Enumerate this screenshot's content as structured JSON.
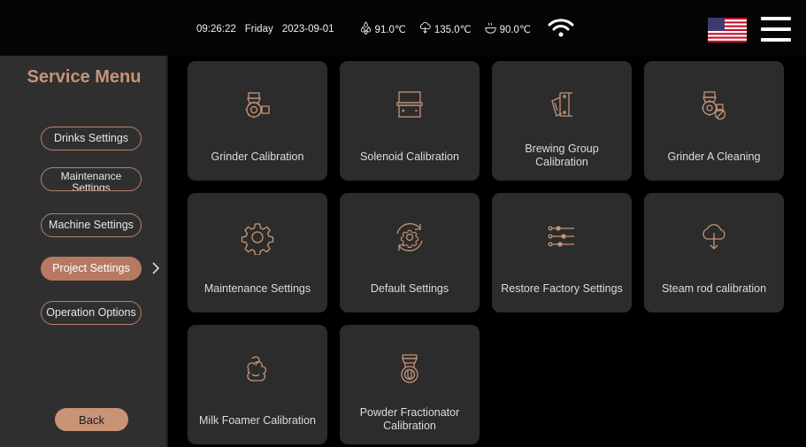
{
  "status": {
    "time": "09:26:22",
    "day": "Friday",
    "date": "2023-09-01",
    "temp1": "91.0℃",
    "temp2": "135.0℃",
    "temp3": "90.0℃"
  },
  "sidebar": {
    "title": "Service Menu",
    "items": [
      {
        "label": "Drinks Settings"
      },
      {
        "label": "Maintenance",
        "label2": "Settings"
      },
      {
        "label": "Machine Settings"
      },
      {
        "label": "Project Settings"
      },
      {
        "label": "Operation Options"
      }
    ],
    "back": "Back"
  },
  "cards": [
    {
      "label": "Grinder Calibration",
      "icon": "grinder-icon"
    },
    {
      "label": "Solenoid Calibration",
      "icon": "solenoid-icon"
    },
    {
      "label": "Brewing Group",
      "label2": "Calibration",
      "icon": "brewing-group-icon"
    },
    {
      "label": "Grinder A Cleaning",
      "icon": "grinder-cleaning-icon"
    },
    {
      "label": "Maintenance Settings",
      "icon": "gear-icon"
    },
    {
      "label": "Default Settings",
      "icon": "gear-reset-icon"
    },
    {
      "label": "Restore Factory Settings",
      "icon": "sliders-icon"
    },
    {
      "label": "Steam rod calibration",
      "icon": "steam-cloud-icon"
    },
    {
      "label": "Milk Foamer Calibration",
      "icon": "milk-foam-icon"
    },
    {
      "label": "Powder Fractionator",
      "label2": "Calibration",
      "icon": "powder-fractionator-icon"
    }
  ],
  "colors": {
    "accent": "#b67a63",
    "title": "#c89377",
    "card": "#2c2c2c",
    "sidebar": "#2f2f2f",
    "icon": "#c89377"
  }
}
